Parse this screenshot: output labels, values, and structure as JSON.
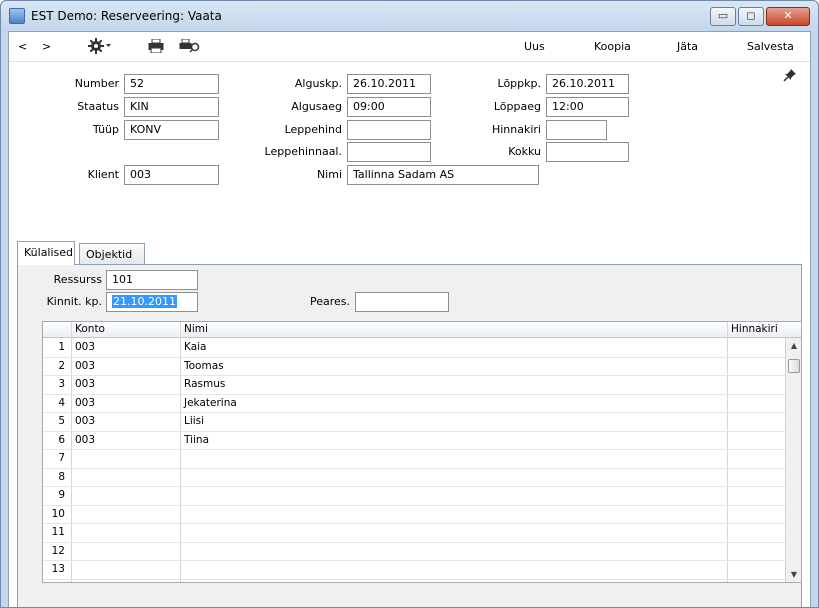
{
  "window": {
    "title": "EST Demo: Reserveering: Vaata",
    "minimize": "▭",
    "maximize": "◻",
    "close": "✕"
  },
  "toolbar": {
    "back": "<",
    "forward": ">",
    "settings_icon": "gear-icon",
    "print_icon": "printer-icon",
    "preview_icon": "print-preview-icon",
    "new": "Uus",
    "copy": "Koopia",
    "cancel": "Jäta",
    "save": "Salvesta"
  },
  "header": {
    "number_label": "Number",
    "number": "52",
    "status_label": "Staatus",
    "status": "KIN",
    "type_label": "Tüüp",
    "type": "KONV",
    "client_label": "Klient",
    "client": "003",
    "start_date_label": "Alguskp.",
    "start_date": "26.10.2011",
    "start_time_label": "Algusaeg",
    "start_time": "09:00",
    "contract_price_label": "Leppehind",
    "contract_price": "",
    "contract_pricelist_label": "Leppehinnaal.",
    "contract_pricelist": "",
    "name_label": "Nimi",
    "name": "Tallinna Sadam AS",
    "end_date_label": "Lõppkp.",
    "end_date": "26.10.2011",
    "end_time_label": "Lõppaeg",
    "end_time": "12:00",
    "pricelist_label": "Hinnakiri",
    "pricelist": "",
    "total_label": "Kokku",
    "total": ""
  },
  "tabs": [
    {
      "label": "Külalised"
    },
    {
      "label": "Objektid"
    }
  ],
  "guests": {
    "resource_label": "Ressurss",
    "resource": "101",
    "confirm_date_label": "Kinnit. kp.",
    "confirm_date": "21.10.2011",
    "stopped_label": "Peares.",
    "stopped": ""
  },
  "grid": {
    "columns": [
      "Konto",
      "Nimi",
      "Hinnakiri"
    ],
    "rows": [
      {
        "n": "1",
        "konto": "003",
        "nimi": "Kaia",
        "hinnakiri": ""
      },
      {
        "n": "2",
        "konto": "003",
        "nimi": "Toomas",
        "hinnakiri": ""
      },
      {
        "n": "3",
        "konto": "003",
        "nimi": "Rasmus",
        "hinnakiri": ""
      },
      {
        "n": "4",
        "konto": "003",
        "nimi": "Jekaterina",
        "hinnakiri": ""
      },
      {
        "n": "5",
        "konto": "003",
        "nimi": "Liisi",
        "hinnakiri": ""
      },
      {
        "n": "6",
        "konto": "003",
        "nimi": "Tiina",
        "hinnakiri": ""
      },
      {
        "n": "7",
        "konto": "",
        "nimi": "",
        "hinnakiri": ""
      },
      {
        "n": "8",
        "konto": "",
        "nimi": "",
        "hinnakiri": ""
      },
      {
        "n": "9",
        "konto": "",
        "nimi": "",
        "hinnakiri": ""
      },
      {
        "n": "10",
        "konto": "",
        "nimi": "",
        "hinnakiri": ""
      },
      {
        "n": "11",
        "konto": "",
        "nimi": "",
        "hinnakiri": ""
      },
      {
        "n": "12",
        "konto": "",
        "nimi": "",
        "hinnakiri": ""
      },
      {
        "n": "13",
        "konto": "",
        "nimi": "",
        "hinnakiri": ""
      }
    ]
  }
}
